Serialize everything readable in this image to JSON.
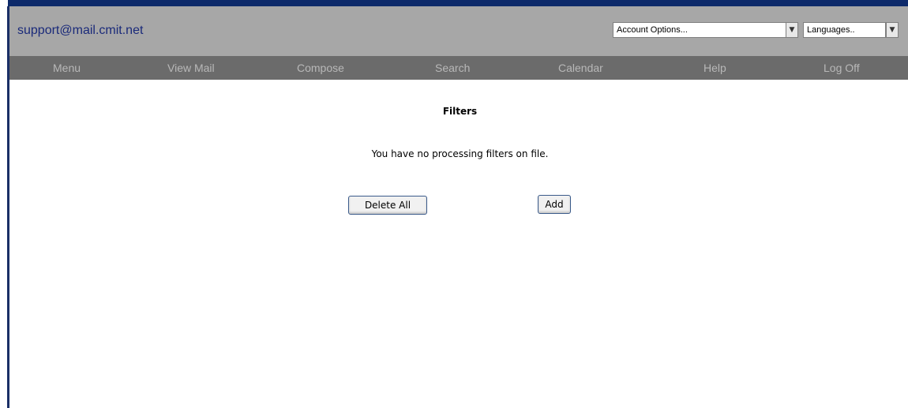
{
  "header": {
    "account_email": "support@mail.cmit.net",
    "account_options": {
      "selected": "Account Options..."
    },
    "languages": {
      "selected": "Languages.."
    }
  },
  "nav": {
    "items": [
      {
        "label": "Menu"
      },
      {
        "label": "View Mail"
      },
      {
        "label": "Compose"
      },
      {
        "label": "Search"
      },
      {
        "label": "Calendar"
      },
      {
        "label": "Help"
      },
      {
        "label": "Log Off"
      }
    ]
  },
  "main": {
    "title": "Filters",
    "message": "You have no processing filters on file.",
    "delete_all_label": "Delete All",
    "add_label": "Add"
  },
  "colors": {
    "header_background": "#a7a7a7",
    "nav_background": "#6b6b6b",
    "nav_text": "#b8b8b8",
    "email_text": "#1a2a7a",
    "border_accent": "#0d2a6a"
  }
}
